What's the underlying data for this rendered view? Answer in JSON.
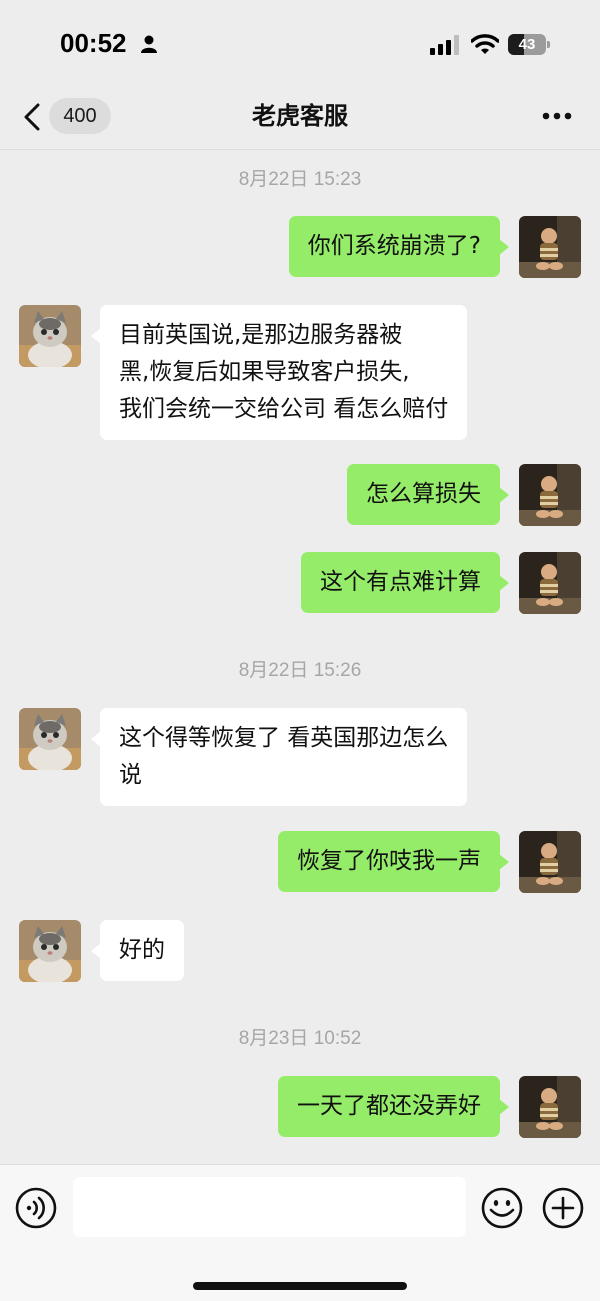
{
  "status_bar": {
    "time": "00:52",
    "battery_level": "43",
    "battery_fraction": 0.43
  },
  "nav": {
    "unread_count": "400",
    "title": "老虎客服"
  },
  "chat": {
    "timestamps": [
      "8月22日 15:23",
      "8月22日 15:26",
      "8月23日 10:52"
    ],
    "messages": [
      {
        "from": "me",
        "text": "你们系统崩溃了?"
      },
      {
        "from": "them",
        "text": "目前英国说,是那边服务器被\n黑,恢复后如果导致客户损失,\n我们会统一交给公司 看怎么赔付"
      },
      {
        "from": "me",
        "text": "怎么算损失"
      },
      {
        "from": "me",
        "text": "这个有点难计算"
      },
      {
        "from": "them",
        "text": "这个得等恢复了 看英国那边怎么\n说"
      },
      {
        "from": "me",
        "text": "恢复了你吱我一声"
      },
      {
        "from": "them",
        "text": "好的"
      },
      {
        "from": "me",
        "text": "一天了都还没弄好"
      }
    ]
  },
  "input": {
    "value": "",
    "placeholder": ""
  },
  "colors": {
    "background": "#ededed",
    "my_bubble": "#95ec69",
    "their_bubble": "#ffffff"
  },
  "icons": {
    "back": "chevron-left-icon",
    "more": "more-dots-icon",
    "voice": "voice-icon",
    "emoji": "emoji-icon",
    "plus": "plus-icon",
    "signal": "signal-icon",
    "wifi": "wifi-icon"
  }
}
